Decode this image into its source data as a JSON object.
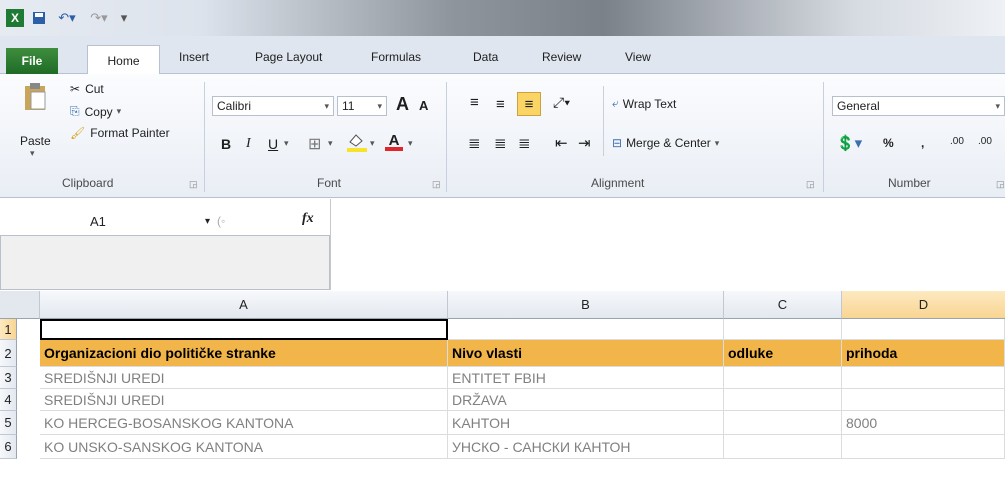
{
  "quick_access": {
    "excel_icon": "excel-icon",
    "save_icon": "save-icon",
    "undo_icon": "undo-icon",
    "redo_icon": "redo-icon"
  },
  "tabs": [
    "File",
    "Home",
    "Insert",
    "Page Layout",
    "Formulas",
    "Data",
    "Review",
    "View"
  ],
  "ribbon": {
    "clipboard": {
      "paste": "Paste",
      "cut": "Cut",
      "copy": "Copy",
      "format_painter": "Format Painter",
      "label": "Clipboard"
    },
    "font": {
      "name": "Calibri",
      "size": "11",
      "bold": "B",
      "italic": "I",
      "underline": "U",
      "grow": "A",
      "shrink": "A",
      "font_color": "A",
      "label": "Font"
    },
    "alignment": {
      "wrap_text": "Wrap Text",
      "merge_center": "Merge & Center",
      "label": "Alignment"
    },
    "number": {
      "format": "General",
      "percent": "%",
      "comma": ",",
      "inc_dec": ".00",
      "dec_dec": ".00",
      "label": "Number"
    }
  },
  "formula_bar": {
    "cell_ref": "A1",
    "fx": "fx",
    "formula": ""
  },
  "columns": [
    "A",
    "B",
    "C",
    "D"
  ],
  "rows": [
    {
      "num": "1",
      "cells": [
        "",
        "",
        "",
        ""
      ]
    },
    {
      "num": "2",
      "cells": [
        "Organizacioni dio političke stranke",
        "Nivo vlasti",
        "odluke",
        "prihoda"
      ]
    },
    {
      "num": "3",
      "cells": [
        "SREDIŠNJI UREDI",
        "ENTITET FBIH",
        "",
        ""
      ]
    },
    {
      "num": "4",
      "cells": [
        "SREDIŠNJI UREDI",
        "DRŽAVA",
        "",
        ""
      ]
    },
    {
      "num": "5",
      "cells": [
        "KO HERCEG-BOSANSKOG KANTONA",
        "KAHTOH",
        "",
        "8000"
      ]
    },
    {
      "num": "6",
      "cells": [
        "KO UNSKO-SANSKOG KANTONA",
        "УНСКО - САНСКИ КАНТОН",
        "",
        ""
      ]
    }
  ],
  "colors": {
    "header_fill": "#f2b54a",
    "file_tab": "#2e7d32"
  }
}
